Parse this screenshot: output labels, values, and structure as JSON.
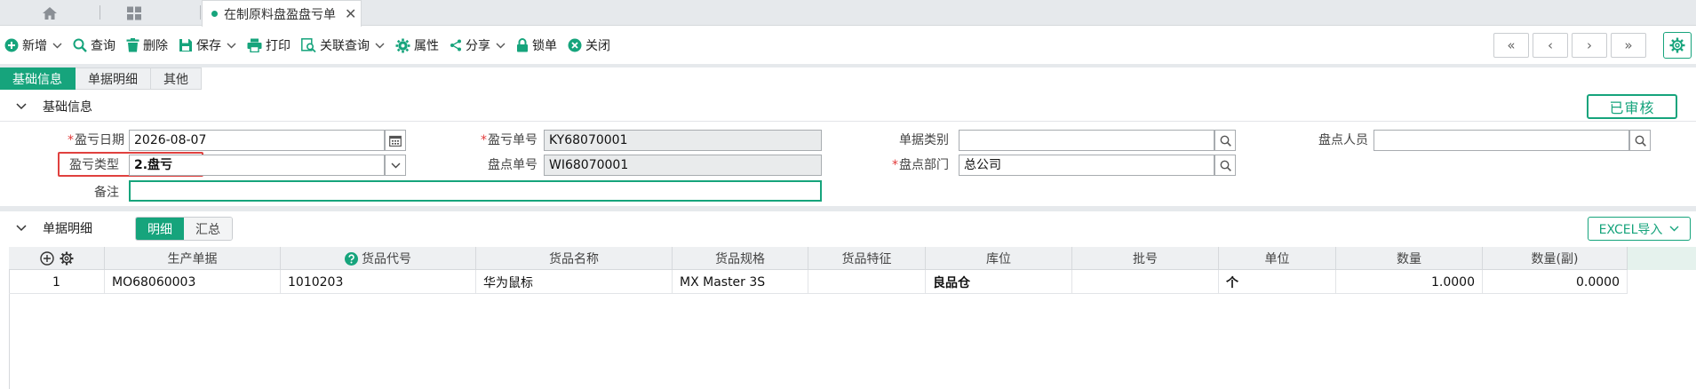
{
  "tabbar": {
    "active_tab_title": "在制原料盘盈盘亏单",
    "close_glyph": "✕"
  },
  "toolbar": {
    "items": [
      {
        "label": "新增",
        "icon": "plus-circle-icon",
        "has_caret": true
      },
      {
        "label": "查询",
        "icon": "search-icon",
        "has_caret": false
      },
      {
        "label": "删除",
        "icon": "trash-icon",
        "has_caret": false
      },
      {
        "label": "保存",
        "icon": "save-icon",
        "has_caret": true
      },
      {
        "label": "打印",
        "icon": "printer-icon",
        "has_caret": false
      },
      {
        "label": "关联查询",
        "icon": "linked-search-icon",
        "has_caret": true
      },
      {
        "label": "属性",
        "icon": "gear-icon",
        "has_caret": false
      },
      {
        "label": "分享",
        "icon": "share-icon",
        "has_caret": true
      },
      {
        "label": "锁单",
        "icon": "lock-icon",
        "has_caret": false
      },
      {
        "label": "关闭",
        "icon": "close-circle-icon",
        "has_caret": false
      }
    ],
    "nav": [
      "«",
      "‹",
      "›",
      "»"
    ]
  },
  "section_tabs": {
    "items": [
      "基础信息",
      "单据明细",
      "其他"
    ],
    "active": 0
  },
  "basic_info": {
    "title": "基础信息",
    "status": "已审核",
    "fields": {
      "pl_date": {
        "label": "盈亏日期",
        "value": "2026-08-07",
        "required": true
      },
      "pl_type": {
        "label": "盈亏类型",
        "value": "2.盘亏",
        "required": false
      },
      "remark": {
        "label": "备注",
        "value": ""
      },
      "pl_no": {
        "label": "盈亏单号",
        "value": "KY68070001",
        "required": true
      },
      "count_no": {
        "label": "盘点单号",
        "value": "WI68070001",
        "required": false
      },
      "doc_category": {
        "label": "单据类别",
        "value": ""
      },
      "count_dept": {
        "label": "盘点部门",
        "value": "总公司",
        "required": true
      },
      "count_person": {
        "label": "盘点人员",
        "value": ""
      }
    },
    "required_mark": "*"
  },
  "detail": {
    "title": "单据明细",
    "segments": [
      "明细",
      "汇总"
    ],
    "active_segment": 0,
    "excel_label": "EXCEL导入",
    "columns": [
      "生产单据",
      "货品代号",
      "货品名称",
      "货品规格",
      "货品特征",
      "库位",
      "批号",
      "单位",
      "数量",
      "数量(副)"
    ],
    "rows": [
      {
        "index": "1",
        "production_doc": "MO68060003",
        "item_code": "1010203",
        "item_name": "华为鼠标",
        "item_spec": "MX Master 3S",
        "item_feature": "",
        "location": "良品仓",
        "batch": "",
        "unit": "个",
        "qty": "1.0000",
        "qty_sub": "0.0000"
      }
    ]
  },
  "colors": {
    "accent": "#16a47c",
    "highlight": "#e0413f",
    "required": "#e23a3a"
  }
}
